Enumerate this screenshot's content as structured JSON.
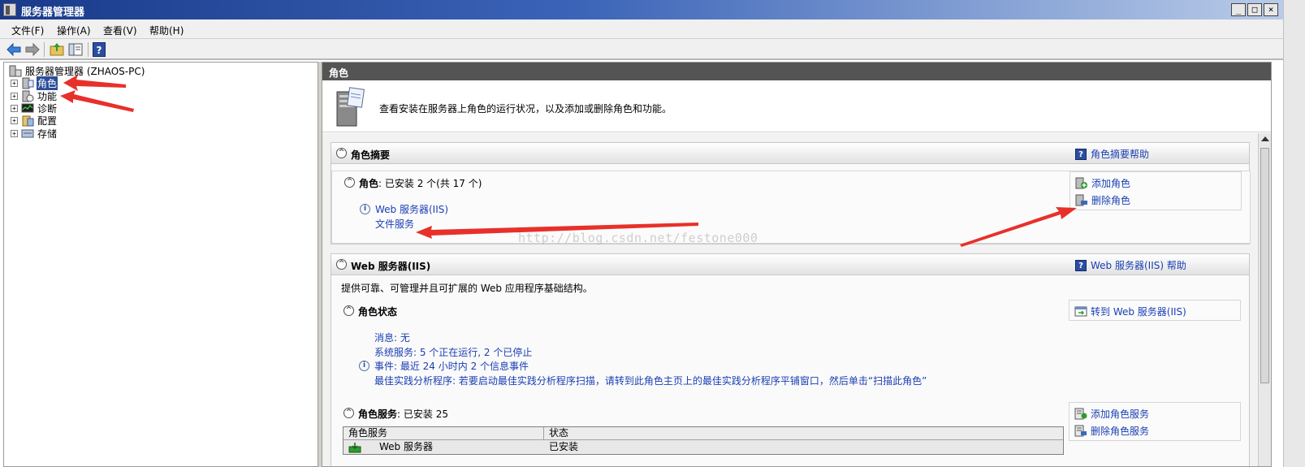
{
  "window": {
    "title": "服务器管理器",
    "buttons": [
      "_",
      "□",
      "×"
    ]
  },
  "menu": {
    "items": [
      "文件(F)",
      "操作(A)",
      "查看(V)",
      "帮助(H)"
    ]
  },
  "toolbar": {
    "icons": [
      "back-arrow-icon",
      "forward-arrow-icon",
      "up-folder-icon",
      "show-hide-tree-icon",
      "help-icon"
    ],
    "help_glyph": "?"
  },
  "tree": {
    "root": "服务器管理器 (ZHAOS-PC)",
    "items": [
      {
        "label": "角色",
        "selected": true
      },
      {
        "label": "功能",
        "selected": false
      },
      {
        "label": "诊断",
        "selected": false
      },
      {
        "label": "配置",
        "selected": false
      },
      {
        "label": "存储",
        "selected": false
      }
    ],
    "expander": "+"
  },
  "right": {
    "header": "角色",
    "intro": "查看安装在服务器上角色的运行状况，以及添加或删除角色和功能。",
    "summary": {
      "title": "角色摘要",
      "help": "角色摘要帮助",
      "roles_label": "角色",
      "roles_status": ": 已安装 2 个(共 17 个)",
      "roles": [
        "Web 服务器(IIS)",
        "文件服务"
      ],
      "actions": [
        "添加角色",
        "删除角色"
      ]
    },
    "web": {
      "title": "Web 服务器(IIS)",
      "help": "Web 服务器(IIS) 帮助",
      "description": "提供可靠、可管理并且可扩展的 Web 应用程序基础结构。",
      "status_title": "角色状态",
      "goto": "转到 Web 服务器(IIS)",
      "status_lines": [
        "消息: 无",
        "系统服务: 5 个正在运行, 2 个已停止",
        "事件: 最近 24 小时内 2 个信息事件",
        "最佳实践分析程序: 若要启动最佳实践分析程序扫描，请转到此角色主页上的最佳实践分析程序平铺窗口，然后单击“扫描此角色”"
      ],
      "services_label": "角色服务",
      "services_status": ": 已安装 25",
      "services_actions": [
        "添加角色服务",
        "删除角色服务"
      ],
      "table_headers": [
        "角色服务",
        "状态"
      ],
      "table_rows": [
        {
          "name": "Web 服务器",
          "status": "已安装"
        }
      ]
    },
    "watermark": "http://blog.csdn.net/festone000"
  },
  "colors": {
    "link": "#1a3fb3",
    "header_bg": "#545454",
    "selection": "#2b4e9a",
    "annotation_arrow": "#e8302a"
  }
}
